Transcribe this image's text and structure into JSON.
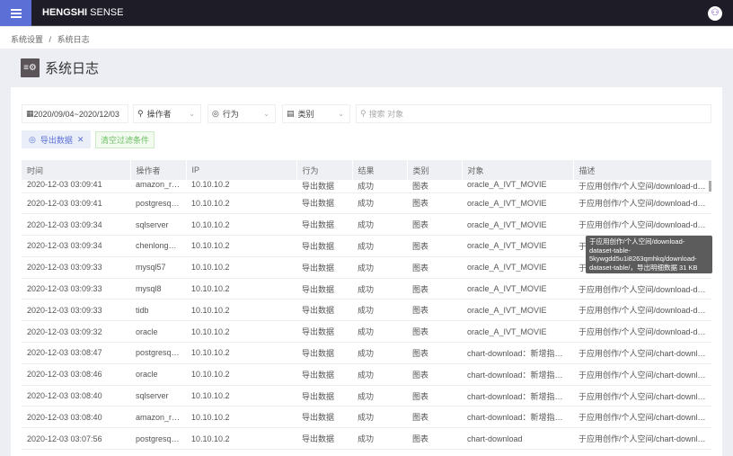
{
  "header": {
    "brand_bold": "HENGSHI",
    "brand_rest": " SENSE",
    "menu_icon": "hamburger-icon",
    "avatar_icon": "user-avatar-icon"
  },
  "breadcrumb": [
    "系统设置",
    "/",
    "系统日志"
  ],
  "page": {
    "title": "系统日志",
    "icon": "log-settings-icon"
  },
  "filters": {
    "date_range": "2020/09/04~2020/12/03",
    "operator": "操作者",
    "action": "行为",
    "category": "类别",
    "search_placeholder": "搜索 对象"
  },
  "active_tag": "导出数据",
  "clear_label": "清空过滤条件",
  "table": {
    "columns": [
      "时间",
      "操作者",
      "IP",
      "行为",
      "结果",
      "类别",
      "对象",
      "描述"
    ],
    "rows": [
      [
        "2020-12-03 03:09:41",
        "amazon_red...",
        "10.10.10.2",
        "导出数据",
        "成功",
        "图表",
        "oracle_A_IVT_MOVIE",
        "于应用创作/个人空间/download-data..."
      ],
      [
        "2020-12-03 03:09:41",
        "postgresql10",
        "10.10.10.2",
        "导出数据",
        "成功",
        "图表",
        "oracle_A_IVT_MOVIE",
        "于应用创作/个人空间/download-data..."
      ],
      [
        "2020-12-03 03:09:34",
        "sqlserver",
        "10.10.10.2",
        "导出数据",
        "成功",
        "图表",
        "oracle_A_IVT_MOVIE",
        "于应用创作/个人空间/download-data..."
      ],
      [
        "2020-12-03 03:09:34",
        "chenlong_u...",
        "10.10.10.2",
        "导出数据",
        "成功",
        "图表",
        "oracle_A_IVT_MOVIE",
        "于应用创作/个人空间/download-data..."
      ],
      [
        "2020-12-03 03:09:33",
        "mysql57",
        "10.10.10.2",
        "导出数据",
        "成功",
        "图表",
        "oracle_A_IVT_MOVIE",
        "于应用创作/个人空间/download-data..."
      ],
      [
        "2020-12-03 03:09:33",
        "mysql8",
        "10.10.10.2",
        "导出数据",
        "成功",
        "图表",
        "oracle_A_IVT_MOVIE",
        "于应用创作/个人空间/download-data..."
      ],
      [
        "2020-12-03 03:09:33",
        "tidb",
        "10.10.10.2",
        "导出数据",
        "成功",
        "图表",
        "oracle_A_IVT_MOVIE",
        "于应用创作/个人空间/download-data..."
      ],
      [
        "2020-12-03 03:09:32",
        "oracle",
        "10.10.10.2",
        "导出数据",
        "成功",
        "图表",
        "oracle_A_IVT_MOVIE",
        "于应用创作/个人空间/download-data..."
      ],
      [
        "2020-12-03 03:08:47",
        "postgresql10",
        "10.10.10.2",
        "导出数据",
        "成功",
        "图表",
        "chart-download：新增指标...",
        "于应用创作/个人空间/chart-download..."
      ],
      [
        "2020-12-03 03:08:46",
        "oracle",
        "10.10.10.2",
        "导出数据",
        "成功",
        "图表",
        "chart-download：新增指标...",
        "于应用创作/个人空间/chart-download..."
      ],
      [
        "2020-12-03 03:08:40",
        "sqlserver",
        "10.10.10.2",
        "导出数据",
        "成功",
        "图表",
        "chart-download：新增指标...",
        "于应用创作/个人空间/chart-download..."
      ],
      [
        "2020-12-03 03:08:40",
        "amazon_red...",
        "10.10.10.2",
        "导出数据",
        "成功",
        "图表",
        "chart-download：新增指标...",
        "于应用创作/个人空间/chart-download..."
      ],
      [
        "2020-12-03 03:07:56",
        "postgresql10",
        "10.10.10.2",
        "导出数据",
        "成功",
        "图表",
        "chart-download",
        "于应用创作/个人空间/chart-download..."
      ]
    ]
  },
  "tooltip": "于应用创作/个人空间/download-dataset-table-5kywgdd5u1i8263qmhkq/download-dataset-table/，导出明细数据 31 KB"
}
